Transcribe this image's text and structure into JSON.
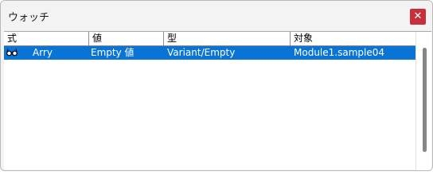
{
  "window": {
    "title": "ウォッチ",
    "close_glyph": "✕"
  },
  "columns": [
    "式",
    "値",
    "型",
    "対象"
  ],
  "rows": [
    {
      "icon": "glasses-icon",
      "expression": "Arry",
      "value": "Empty 値",
      "type": "Variant/Empty",
      "context": "Module1.sample04",
      "selected": true
    }
  ],
  "colors": {
    "selection": "#0a74d6",
    "close_button": "#c7303a"
  }
}
